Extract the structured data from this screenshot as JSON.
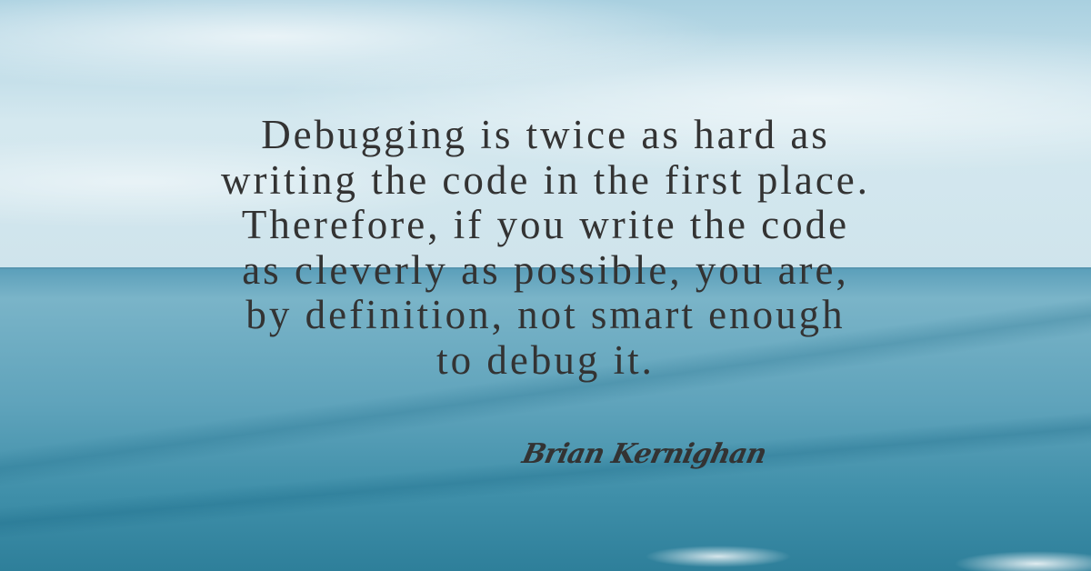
{
  "quote": {
    "lines": [
      "Debugging is twice as hard as",
      "writing the code in the first place.",
      "Therefore, if you write the code",
      "as cleverly as possible, you are,",
      "by definition, not smart enough",
      "to debug it."
    ]
  },
  "author": "Brian Kernighan",
  "colors": {
    "text": "#333333",
    "sky": "#cfe4ec",
    "sea": "#3f8fa9"
  }
}
